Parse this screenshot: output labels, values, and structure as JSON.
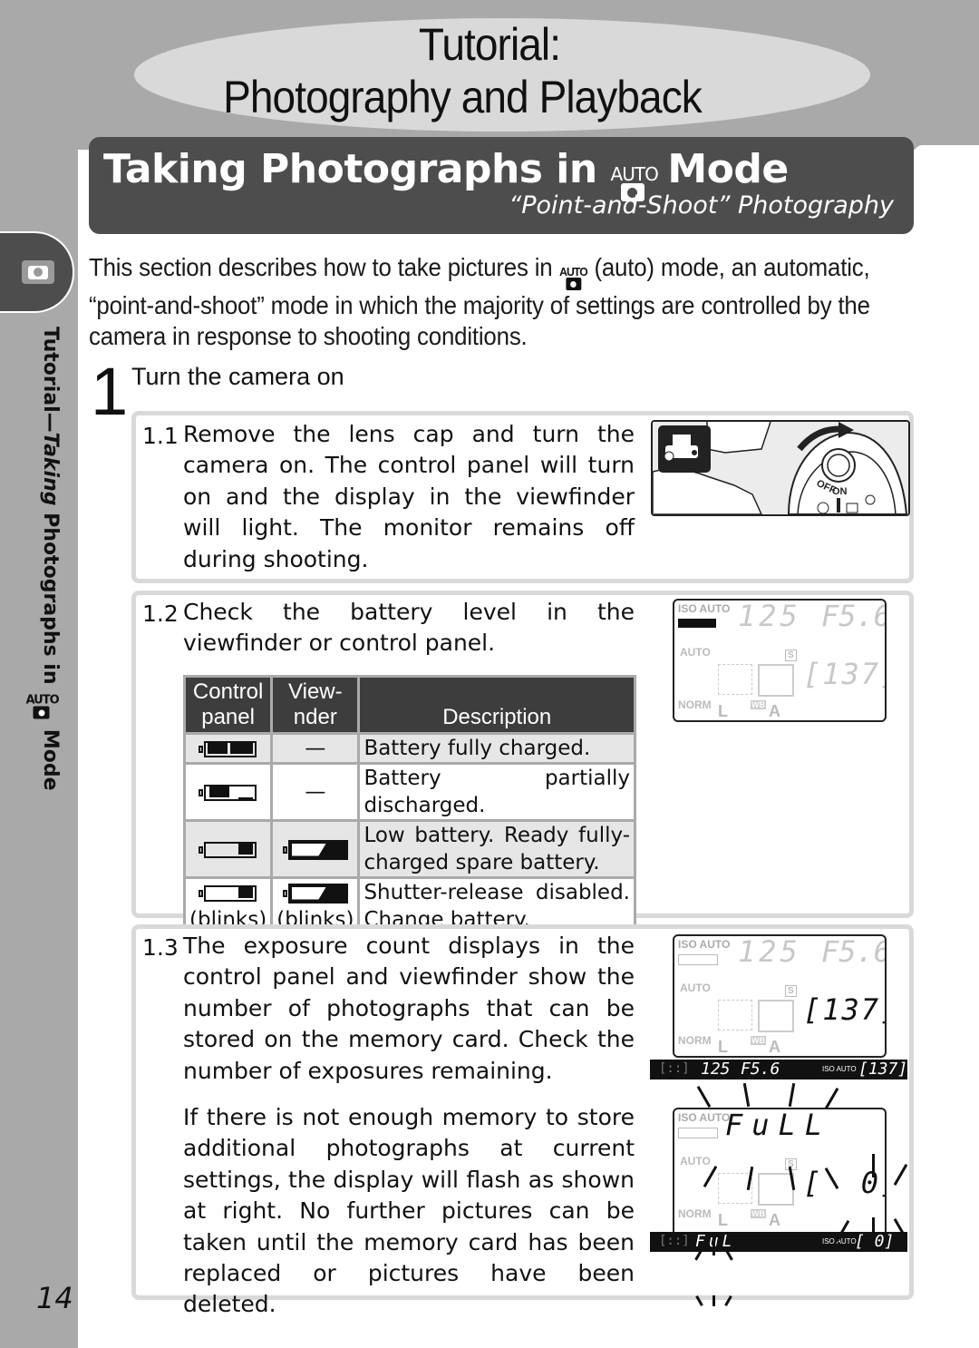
{
  "chapter": {
    "title_line1": "Tutorial:",
    "title_line2": "Photography and Playback"
  },
  "section": {
    "title_prefix": "Taking Photographs in",
    "title_suffix": "Mode",
    "mode_icon_label": "AUTO",
    "subtitle": "“Point-and-Shoot” Photography"
  },
  "side_tab": {
    "icon": "camera-icon",
    "label_prefix": "Tutorial—",
    "label_italic": "Taking",
    "label_main": " Photographs in",
    "label_icon": "AUTO",
    "label_suffix": "Mode"
  },
  "intro": {
    "part1": "This section describes how to take pictures in",
    "icon": "AUTO",
    "part2": "(auto) mode, an automatic, “point-and-shoot” mode in which the majority of settings are controlled by the camera in response to shooting conditions."
  },
  "step": {
    "number": "1",
    "title": "Turn the camera on"
  },
  "substeps": [
    {
      "number": "1.1",
      "text": "Remove the lens cap and turn the camera on.  The control panel will turn on and the display in the viewfinder will light.  The monitor remains off during shooting.",
      "figure": {
        "switch_off": "OFF",
        "switch_on": "ON"
      }
    },
    {
      "number": "1.2",
      "text": "Check the battery level in the viewfinder or control panel.",
      "table": {
        "headers": [
          "Control panel",
          "Viewfinder",
          "Description"
        ],
        "header_display": [
          "Control\npanel",
          "View-\nnder",
          "Description"
        ],
        "rows": [
          {
            "control_panel": "battery-full-icon",
            "viewfinder": "—",
            "description": "Battery fully charged."
          },
          {
            "control_panel": "battery-partial-icon",
            "viewfinder": "—",
            "description": "Battery partially discharged."
          },
          {
            "control_panel": "battery-low-icon",
            "viewfinder": "viewfinder-battery-low-icon",
            "description": "Low battery.  Ready fully-charged spare battery."
          },
          {
            "control_panel": "battery-low-icon",
            "control_panel_note": "(blinks)",
            "viewfinder": "viewfinder-battery-low-icon",
            "viewfinder_note": "(blinks)",
            "description": "Shutter-release disabled. Change battery."
          }
        ]
      }
    },
    {
      "number": "1.3",
      "text": "The exposure count displays in the control panel and viewfinder show the number of photographs that can be stored on the memory card.  Check the number of exposures remaining.",
      "text2": "If there is not enough memory to store additional photographs at current settings, the display will flash as shown at right.  No further pictures can be taken until the memory card has been replaced or pictures have been deleted."
    }
  ],
  "lcd_panel": {
    "iso": "ISO AUTO",
    "shutter": "125",
    "aperture": "F5.6",
    "flash_mode": "AUTO",
    "af_mode": "S",
    "count": "[137]",
    "quality": "NORM",
    "size": "L",
    "wb_label": "WB",
    "wb": "A"
  },
  "viewfinder": {
    "shutter": "125",
    "aperture": "F5.6",
    "iso": "ISO AUTO",
    "count": "[137]"
  },
  "lcd_full": {
    "iso": "ISO AUTO",
    "message": "FuLL",
    "flash_mode": "AUTO",
    "af_mode": "S",
    "count": "[  0]",
    "quality": "NORM",
    "size": "L",
    "wb_label": "WB",
    "wb": "A"
  },
  "viewfinder_full": {
    "message": "FuL",
    "iso": "ISO AUTO",
    "count": "[ 0]"
  },
  "page_number": "14"
}
